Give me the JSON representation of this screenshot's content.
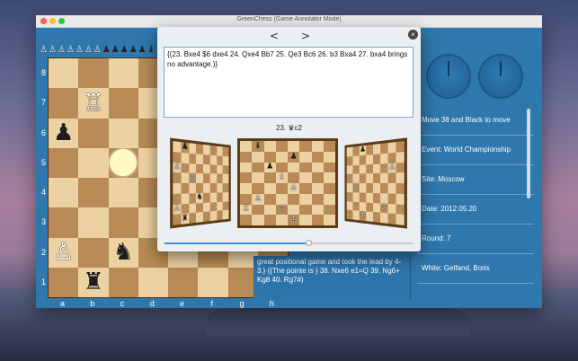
{
  "window": {
    "title": "GreenChess (Game Annotator Mode)"
  },
  "captured": {
    "white": [
      "♙",
      "♙",
      "♙",
      "♙",
      "♙",
      "♙",
      "♙"
    ],
    "black": [
      "♟",
      "♟",
      "♟",
      "♟",
      "♟",
      "♝",
      "♞",
      "♜",
      "♛",
      "♟"
    ]
  },
  "board": {
    "ranks": [
      "8",
      "7",
      "6",
      "5",
      "4",
      "3",
      "2",
      "1"
    ],
    "files": [
      "a",
      "b",
      "c",
      "d",
      "e",
      "f",
      "g",
      "h"
    ],
    "light_color": "#ecd2a3",
    "dark_color": "#b88a55",
    "pieces": [
      {
        "sq": "b7",
        "glyph": "♖",
        "side": "w"
      },
      {
        "sq": "a6",
        "glyph": "♟",
        "side": "b"
      },
      {
        "sq": "a2",
        "glyph": "♙",
        "side": "w"
      },
      {
        "sq": "c2",
        "glyph": "♞",
        "side": "b"
      },
      {
        "sq": "b1",
        "glyph": "♜",
        "side": "b"
      }
    ],
    "highlights": [
      "c5"
    ]
  },
  "annotator": {
    "prev": "<",
    "next": ">",
    "close": "×",
    "comment": "{(23. Bxe4 $6 dxe4 24. Qxe4 Bb7 25. Qe3 Bc6 26. b3 Bxa4 27. bxa4 brings no advantage.)}",
    "move_label": "23. ♛c2",
    "slider_fraction": 0.58
  },
  "notes": {
    "text": "great positional game and took the lead by 4-3.} ({The pointe is } 38. Nxe6 e1=Q 39. Ng6+ Kg8 40. Rg7#)"
  },
  "info": [
    "Move 38 and Black to move",
    "Event:  World Championship",
    "Site:  Moscow",
    "Date:  2012.05.20",
    "Round:  7",
    "White:  Gelfand, Boris"
  ]
}
